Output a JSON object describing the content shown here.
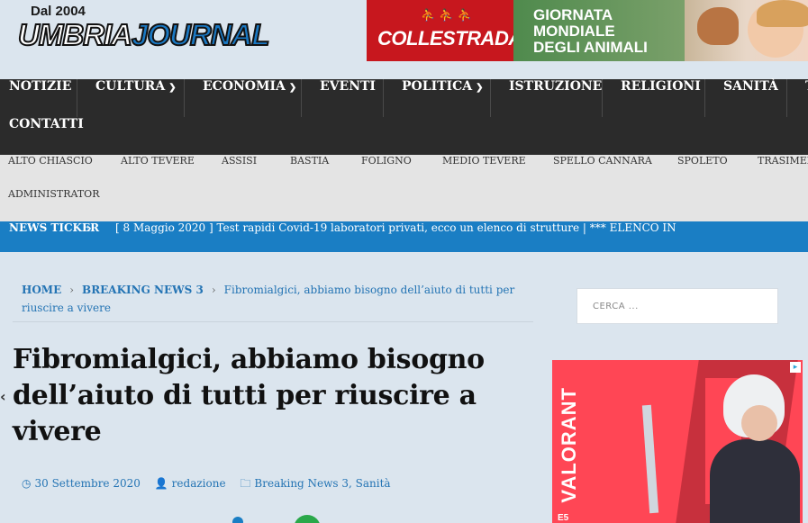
{
  "header": {
    "logo_since": "Dal 2004",
    "logo_brand_main": "UMBRIA",
    "logo_brand_accent": "JOURNAL"
  },
  "banner": {
    "sponsor": "COLLESTRADA",
    "sponsor_icon": "cyclists-icon",
    "line1": "GIORNATA",
    "line2": "MONDIALE",
    "line3": "DEGLI ANIMALI"
  },
  "main_nav": [
    {
      "label": "NOTIZIE",
      "dropdown": false
    },
    {
      "label": "CULTURA",
      "dropdown": true
    },
    {
      "label": "ECONOMIA",
      "dropdown": true
    },
    {
      "label": "EVENTI",
      "dropdown": false
    },
    {
      "label": "POLITICA",
      "dropdown": true
    },
    {
      "label": "ISTRUZIONE",
      "dropdown": false
    },
    {
      "label": "RELIGIONI",
      "dropdown": false
    },
    {
      "label": "SANITÀ",
      "dropdown": false
    },
    {
      "label": "T",
      "dropdown": false
    },
    {
      "label": "CONTATTI",
      "dropdown": false
    }
  ],
  "sub_nav": [
    "ALTO CHIASCIO",
    "ALTO TEVERE",
    "ASSISI",
    "BASTIA",
    "FOLIGNO",
    "MEDIO TEVERE",
    "SPELLO CANNARA",
    "SPOLETO",
    "TRASIMENO",
    "ADMINISTRATOR"
  ],
  "ticker": {
    "label": "NEWS TICKER",
    "text": "[ 8 Maggio 2020 ]  Test rapidi Covid-19 laboratori privati, ecco un elenco di strutture | *** ELENCO IN"
  },
  "breadcrumb": {
    "home": "HOME",
    "section": "BREAKING NEWS 3",
    "current": "Fibromialgici, abbiamo bisogno dell’aiuto di tutti per riuscire a vivere"
  },
  "article": {
    "title": "Fibromialgici, abbiamo bisogno dell’aiuto di tutti per riuscire a vivere",
    "date": "30 Settembre 2020",
    "author": "redazione",
    "categories": "Breaking News 3, Sanità"
  },
  "sidebar": {
    "search_placeholder": "CERCA ...",
    "ad_text": "VALORANT",
    "ad_footer": "E5"
  },
  "colors": {
    "nav_bg": "#2b2b2b",
    "ticker_bg": "#1a7ec4",
    "link": "#2474b4",
    "page_bg": "#dbe5ee"
  }
}
